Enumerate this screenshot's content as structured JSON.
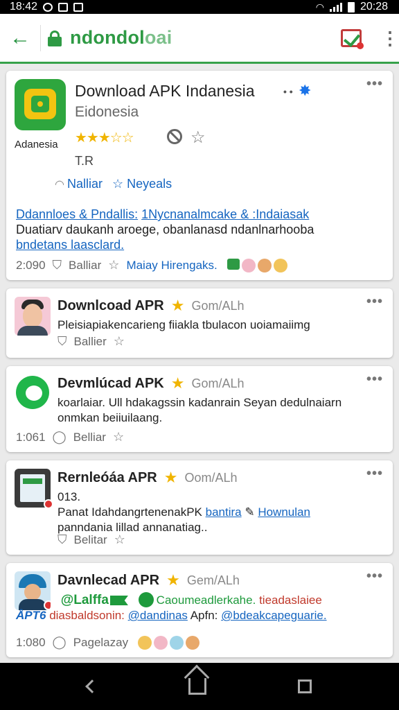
{
  "status_bar": {
    "time": "18:42",
    "right_time": "20:28"
  },
  "toolbar": {
    "url_dark": "ndondol",
    "url_light": "oai",
    "back_icon": "back-arrow-icon",
    "lock_icon": "lock-icon",
    "check_icon": "checkmark-icon",
    "more_icon": "more-vert-icon"
  },
  "cards": [
    {
      "title": "Download APK Indanesia",
      "subtitle": "Eidonesia",
      "icon_label": "Adanesia",
      "title_dots": "• •",
      "rating_stars": "★★★☆☆",
      "tr_label": "T.R",
      "link1": "Nalliar",
      "link2": "Neyeals",
      "desc_link1": "Ddannloes & Pndallis:",
      "desc_link2": "1Nycnanalmcake & :Indaiasak",
      "desc_rest": "Duatiarv daukanh aroege, obanlanasd ndanlnarhooba",
      "desc_link3": "bndetans laasclard.",
      "count": "2:090",
      "save_label": "Balliar",
      "star_link": "Maiay Hirengaks."
    },
    {
      "name": "Downlcoad APR",
      "handle": "Gom/ALh",
      "text": "Pleisiapiakencarieng fiiakla tbulacon uoiamaiimg",
      "save_label": "Ballier"
    },
    {
      "name": "Devmlúcad APK",
      "handle": "Gom/ALh",
      "text": "koarlaiar. Ull hdakagssin kadanrain Seyan dedulnaiarn onmkan beiiuilaang.",
      "count": "1:061",
      "reply_label": "Belliar"
    },
    {
      "name": "Rernleóáa APR",
      "handle": "Oom/ALh",
      "line1": "013.",
      "line2_text": "Panat IdahdangrtenenakPK",
      "line2_link1": "bantira",
      "line2_link2": "Hownulan",
      "line3": "panndania lillad annanatiag..",
      "save_label": "Belitar"
    },
    {
      "name": "Davnlecad APR",
      "handle": "Gem/ALh",
      "green_tag": "@Lalffa",
      "green_text": "Caoumeadlerkahe.",
      "red_text": "tieadaslaiee",
      "tag_blue": "ÅPT6",
      "red_line2": "diasbaldsonin:",
      "blue_link": "@dandinas",
      "rest2": "Apfn:",
      "blue_link2": "@bdeakcapeguarie.",
      "count": "1:080",
      "reply_label": "Pagelazay"
    }
  ],
  "nav": {
    "back_icon": "nav-back-icon",
    "home_icon": "nav-home-icon",
    "recent_icon": "nav-recent-icon"
  }
}
